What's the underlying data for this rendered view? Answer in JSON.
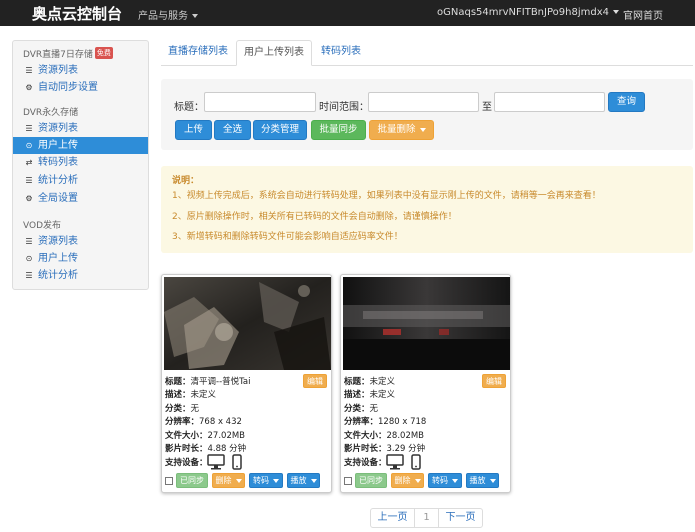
{
  "header": {
    "brand": "奥点云控制台",
    "menu": "产品与服务",
    "user": "oGNaqs54mrvNFITBnJPo9h8jmdx4",
    "home_link": "官网首页"
  },
  "sidebar": {
    "group1": "DVR直播7日存储",
    "free_badge": "免费",
    "group1_items": [
      {
        "label": "资源列表",
        "icon": "list-icon"
      },
      {
        "label": "自动同步设置",
        "icon": "gear-icon"
      }
    ],
    "group2": "DVR永久存储",
    "group2_items": [
      {
        "label": "资源列表",
        "icon": "list-icon"
      },
      {
        "label": "用户上传",
        "icon": "upload-icon"
      },
      {
        "label": "转码列表",
        "icon": "retweet-icon"
      },
      {
        "label": "统计分析",
        "icon": "stats-icon"
      },
      {
        "label": "全局设置",
        "icon": "gear-icon"
      }
    ],
    "group3": "VOD发布",
    "group3_items": [
      {
        "label": "资源列表",
        "icon": "list-icon"
      },
      {
        "label": "用户上传",
        "icon": "upload-icon"
      },
      {
        "label": "统计分析",
        "icon": "stats-icon"
      }
    ]
  },
  "tabs": [
    "直播存储列表",
    "用户上传列表",
    "转码列表"
  ],
  "filter": {
    "title_label": "标题：",
    "time_label": "时间范围：",
    "to_label": "至",
    "title_value": "",
    "start_value": "",
    "end_value": "",
    "search": "查询"
  },
  "actions": {
    "upload": "上传",
    "select_all": "全选",
    "category": "分类管理",
    "batch_sync": "批量同步",
    "batch_delete": "批量删除"
  },
  "notice": {
    "title": "说明：",
    "lines": [
      "1、视频上传完成后，系统会自动进行转码处理，如果列表中没有显示刚上传的文件，请稍等一会再来查看！",
      "2、原片删除操作时，相关所有已转码的文件会自动删除，请谨慎操作！",
      "3、新增转码和删除转码文件可能会影响自适应码率文件！"
    ]
  },
  "cards": [
    {
      "title_label": "标题：",
      "title": "清平调--普悦Tai",
      "desc_label": "描述：",
      "desc": "未定义",
      "cat_label": "分类：",
      "cat": "无",
      "res_label": "分辨率：",
      "res": "768 x 432",
      "size_label": "文件大小：",
      "size": "27.02MB",
      "dur_label": "影片时长：",
      "dur": "4.88 分钟",
      "dev_label": "支持设备：",
      "edit": "编辑",
      "synced": "已同步",
      "delete": "删除",
      "transcode": "转码",
      "play": "播放"
    },
    {
      "title_label": "标题：",
      "title": "未定义",
      "desc_label": "描述：",
      "desc": "未定义",
      "cat_label": "分类：",
      "cat": "无",
      "res_label": "分辨率：",
      "res": "1280 x 718",
      "size_label": "文件大小：",
      "size": "28.02MB",
      "dur_label": "影片时长：",
      "dur": "3.29 分钟",
      "dev_label": "支持设备：",
      "edit": "编辑",
      "synced": "已同步",
      "delete": "删除",
      "transcode": "转码",
      "play": "播放"
    }
  ],
  "pager": {
    "prev": "上一页",
    "page": "1",
    "next": "下一页"
  }
}
